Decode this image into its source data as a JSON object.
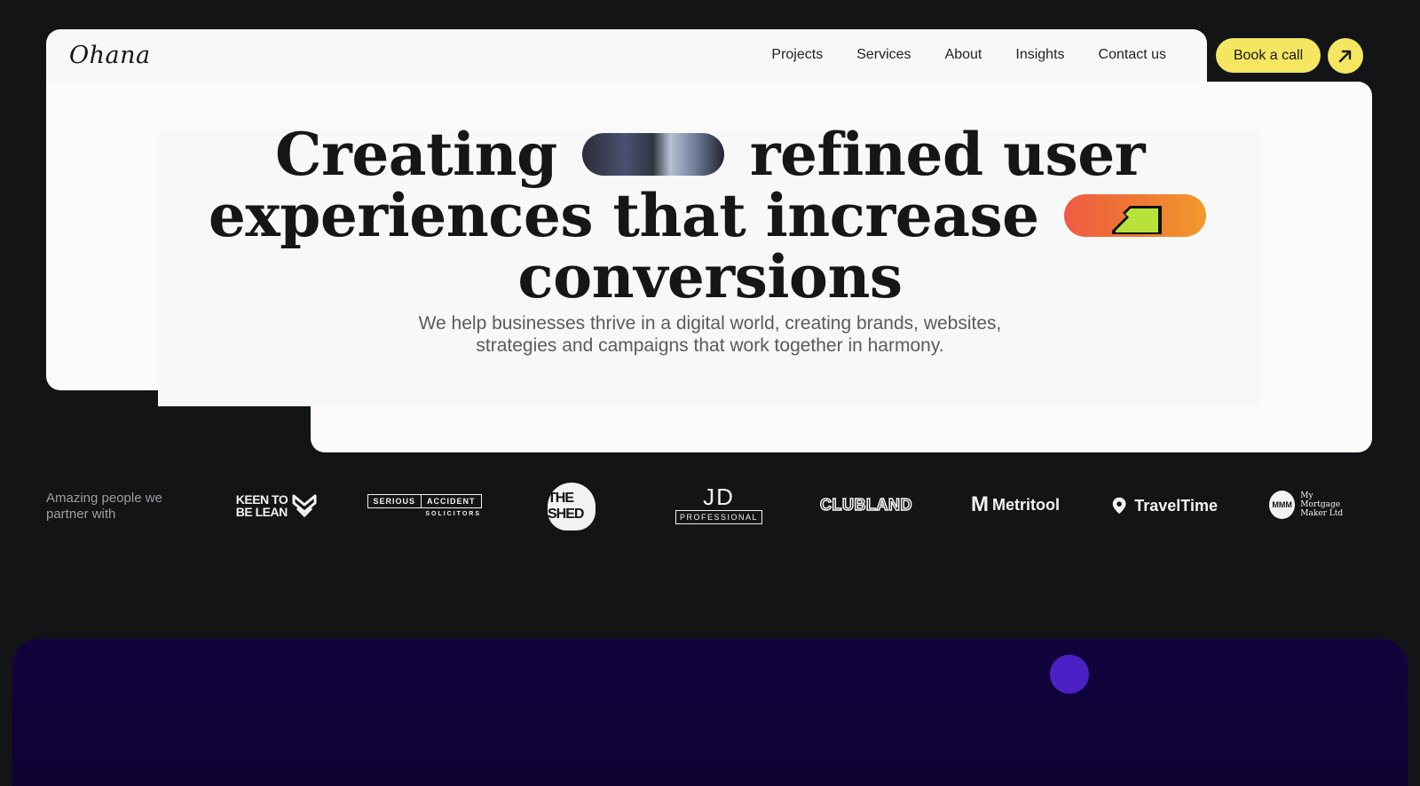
{
  "brand": {
    "logo_text": "Ohana"
  },
  "nav": {
    "links": [
      {
        "label": "Projects"
      },
      {
        "label": "Services"
      },
      {
        "label": "About"
      },
      {
        "label": "Insights"
      },
      {
        "label": "Contact us"
      }
    ],
    "cta_label": "Book a call",
    "cta_icon": "arrow-up-right-icon"
  },
  "hero": {
    "headline_line1_a": "Creating",
    "headline_line1_b": "refined user",
    "headline_line2": "experiences that increase",
    "headline_line3": "conversions",
    "subtitle_line1": "We help businesses thrive in a digital world, creating brands, websites,",
    "subtitle_line2": "strategies and campaigns that work together in harmony."
  },
  "partners": {
    "label": "Amazing people we partner with",
    "logos": {
      "keen_line1": "KEEN TO",
      "keen_line2": "BE LEAN",
      "serious_a": "SERIOUS",
      "serious_b": "ACCIDENT",
      "serious_sub": "SOLICITORS",
      "shed": "THE SHED",
      "jd_big": "JD",
      "jd_box": "PROFESSIONAL",
      "clubland": "CLUBLAND",
      "metritool_mark": "M",
      "metritool": "Metritool",
      "traveltime": "TravelTime",
      "mortgage_mark": "MMM",
      "mortgage_line1": "My Mortgage",
      "mortgage_line2": "Maker Ltd"
    }
  },
  "colors": {
    "background": "#131416",
    "card": "#fdfbfa",
    "accent_yellow": "#f4e661",
    "purple_section": "#12033d",
    "purple_dot": "#4a21c4"
  }
}
